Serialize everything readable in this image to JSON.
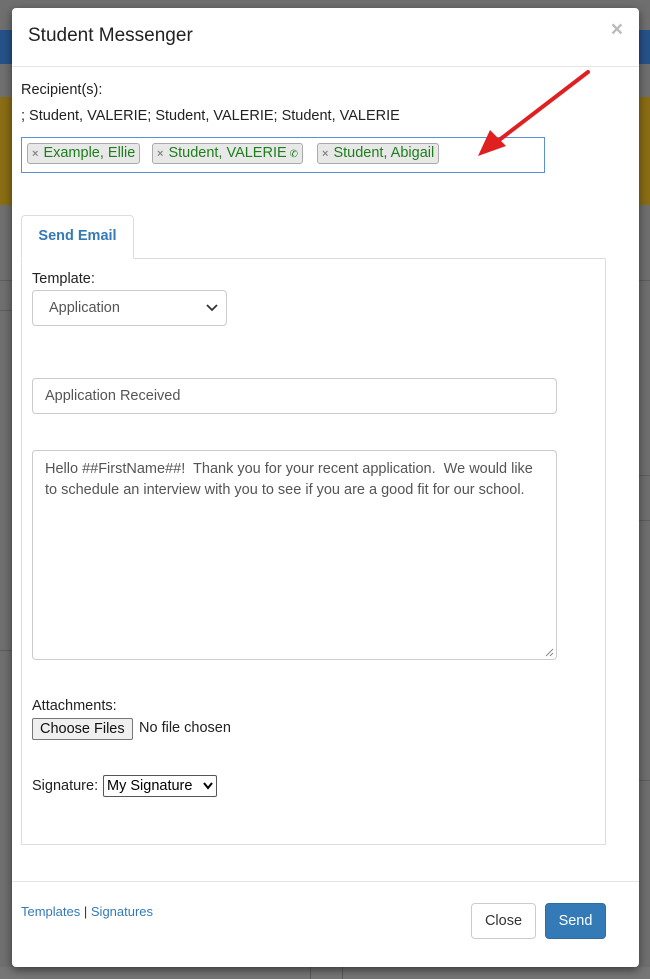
{
  "modal": {
    "title": "Student Messenger",
    "close_glyph": "×"
  },
  "recipients": {
    "label": "Recipient(s):",
    "summary": "; Student, VALERIE; Student, VALERIE; Student, VALERIE",
    "tags": [
      {
        "name": "Example, Ellie",
        "remove_glyph": "×",
        "phone": false
      },
      {
        "name": "Student, VALERIE",
        "remove_glyph": "×",
        "phone": true,
        "phone_icon": "phone-icon"
      },
      {
        "name": "Student, Abigail",
        "remove_glyph": "×",
        "phone": false
      }
    ],
    "tag_text_color": "#1c7f1c"
  },
  "annotation": {
    "arrow_color": "#e02020"
  },
  "tabs": [
    {
      "label": "Send Email",
      "active": true
    }
  ],
  "form": {
    "template_label": "Template:",
    "template_value": "Application",
    "subject_value": "Application Received",
    "body_value": "Hello ##FirstName##!  Thank you for your recent application.  We would like to schedule an interview with you to see if you are a good fit for our school.",
    "attachments_label": "Attachments:",
    "choose_files_label": "Choose Files",
    "no_file_text": "No file chosen",
    "signature_label": "Signature:",
    "signature_value": "My Signature"
  },
  "footer": {
    "templates_link": "Templates",
    "separator": "|",
    "signatures_link": "Signatures",
    "close_label": "Close",
    "send_label": "Send"
  },
  "colors": {
    "link": "#337ab7",
    "primary_button": "#337ab7"
  }
}
